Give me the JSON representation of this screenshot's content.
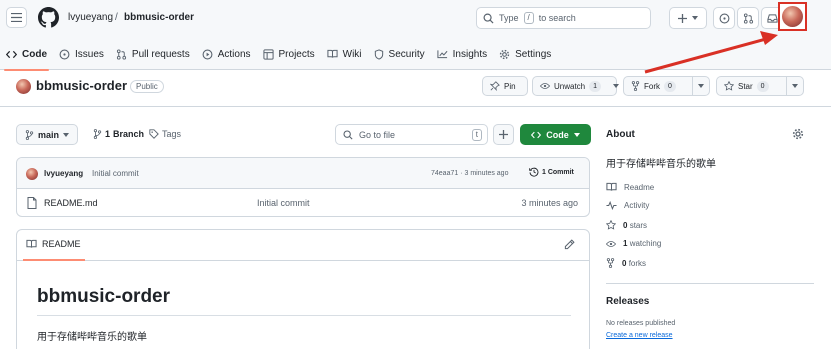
{
  "header": {
    "owner": "lvyueyang",
    "separator": "/",
    "repo": "bbmusic-order",
    "search_prefix": "Type",
    "search_key": "/",
    "search_suffix": "to search"
  },
  "tabs": [
    {
      "label": "Code",
      "icon": "code-icon"
    },
    {
      "label": "Issues",
      "icon": "issue-icon"
    },
    {
      "label": "Pull requests",
      "icon": "pull-request-icon"
    },
    {
      "label": "Actions",
      "icon": "play-icon"
    },
    {
      "label": "Projects",
      "icon": "table-icon"
    },
    {
      "label": "Wiki",
      "icon": "book-icon"
    },
    {
      "label": "Security",
      "icon": "shield-icon"
    },
    {
      "label": "Insights",
      "icon": "graph-icon"
    },
    {
      "label": "Settings",
      "icon": "gear-icon"
    }
  ],
  "repo": {
    "name": "bbmusic-order",
    "visibility": "Public",
    "pin_label": "Pin",
    "unwatch_label": "Unwatch",
    "unwatch_count": "1",
    "fork_label": "Fork",
    "fork_count": "0",
    "star_label": "Star",
    "star_count": "0"
  },
  "branch_bar": {
    "branch": "main",
    "branch_count_num": "1",
    "branch_count_label": "Branch",
    "tags_label": "Tags",
    "goto_placeholder": "Go to file",
    "goto_key": "t",
    "code_label": "Code"
  },
  "commit": {
    "author": "lvyueyang",
    "message": "Initial commit",
    "hash": "74eaa71",
    "time": "· 3 minutes ago",
    "count": "1 Commit"
  },
  "files": [
    {
      "name": "README.md",
      "commit": "Initial commit",
      "time": "3 minutes ago"
    }
  ],
  "readme": {
    "tab_label": "README",
    "heading": "bbmusic-order",
    "body": "用于存储哔哔音乐的歌单"
  },
  "about": {
    "title": "About",
    "description": "用于存储哔哔音乐的歌单",
    "readme_label": "Readme",
    "activity_label": "Activity",
    "stars_num": "0",
    "stars_label": "stars",
    "watching_num": "1",
    "watching_label": "watching",
    "forks_num": "0",
    "forks_label": "forks"
  },
  "releases": {
    "title": "Releases",
    "none_text": "No releases published",
    "create_link": "Create a new release"
  },
  "colors": {
    "accent_green": "#1f883d",
    "tab_underline": "#fd8c73",
    "link_blue": "#0969da",
    "annotation_red": "#d93025"
  }
}
